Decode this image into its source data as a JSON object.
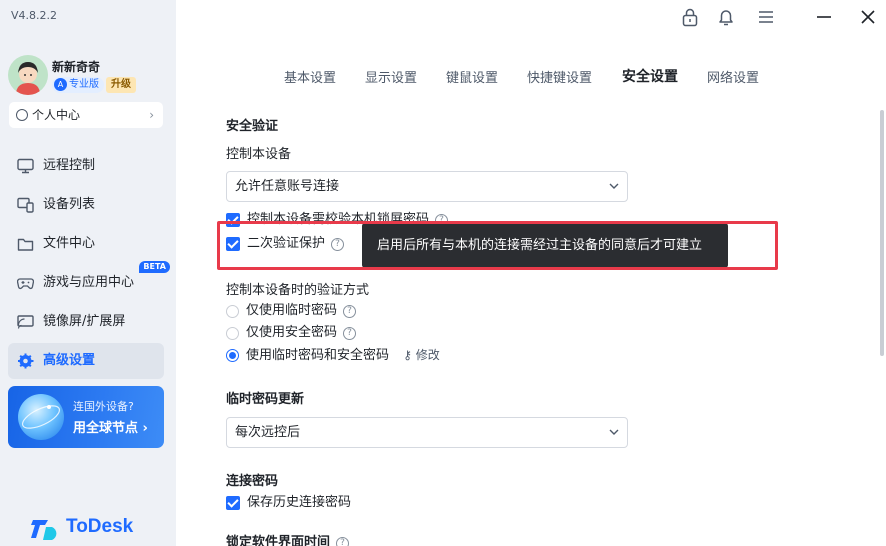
{
  "app": {
    "version": "V4.8.2.2"
  },
  "user": {
    "name": "新新奇奇",
    "pro_badge": "专业版",
    "upgrade_label": "升级",
    "personal_center": "个人中心"
  },
  "sidebar": {
    "items": [
      {
        "label": "远程控制",
        "icon": "monitor-icon"
      },
      {
        "label": "设备列表",
        "icon": "devices-icon"
      },
      {
        "label": "文件中心",
        "icon": "folder-icon"
      },
      {
        "label": "游戏与应用中心",
        "icon": "gamepad-icon",
        "badge": "BETA"
      },
      {
        "label": "镜像屏/扩展屏",
        "icon": "mirror-screen-icon"
      },
      {
        "label": "高级设置",
        "icon": "gear-icon",
        "active": true
      }
    ],
    "promo": {
      "line1": "连国外设备?",
      "line2": "用全球节点 ›"
    },
    "logo_text": "ToDesk"
  },
  "window_controls": [
    "lock-icon",
    "bell-icon",
    "menu-icon",
    "minimize-icon",
    "close-icon"
  ],
  "tabs": [
    {
      "label": "基本设置"
    },
    {
      "label": "显示设置"
    },
    {
      "label": "键鼠设置"
    },
    {
      "label": "快捷键设置"
    },
    {
      "label": "安全设置",
      "active": true
    },
    {
      "label": "网络设置"
    }
  ],
  "security": {
    "section_title": "安全验证",
    "control_device_label": "控制本设备",
    "control_device_value": "允许任意账号连接",
    "checkbox_lock_screen": "控制本设备需校验本机锁屏密码",
    "checkbox_2fa": "二次验证保护",
    "tooltip_2fa": "启用后所有与本机的连接需经过主设备的同意后才可建立",
    "verify_method_label": "控制本设备时的验证方式",
    "radio_temp_only": "仅使用临时密码",
    "radio_secure_only": "仅使用安全密码",
    "radio_both": "使用临时密码和安全密码",
    "edit_label": "修改",
    "temp_pwd_update_title": "临时密码更新",
    "temp_pwd_update_value": "每次远控后",
    "conn_pwd_title": "连接密码",
    "checkbox_save_history": "保存历史连接密码",
    "lock_ui_time_title": "锁定软件界面时间"
  },
  "colors": {
    "accent": "#1f6bff",
    "sidebar_bg": "#eef1f6",
    "highlight_box": "#e83a4a",
    "tooltip_bg": "#2b2d31"
  }
}
